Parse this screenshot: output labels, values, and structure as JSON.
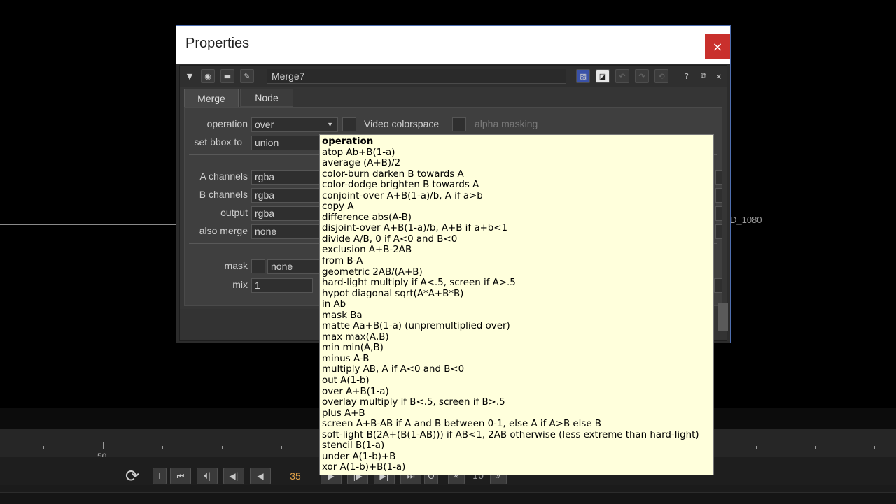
{
  "viewer": {
    "format_label": "D_1080"
  },
  "timeline": {
    "tick_label": "50",
    "current_frame": "35",
    "increment": "10",
    "buttons": [
      "I",
      "⏮",
      "⏴|",
      "◀|",
      "◀",
      "▶",
      "|▶",
      "▶|",
      "⏭",
      "O"
    ]
  },
  "window": {
    "title": "Properties",
    "close_label": "×",
    "node_name": "Merge7",
    "tabs": [
      {
        "label": "Merge",
        "active": true
      },
      {
        "label": "Node",
        "active": false
      }
    ],
    "toolbar_right": [
      "?",
      "⧉",
      "×"
    ],
    "fields": {
      "operation_label": "operation",
      "operation_value": "over",
      "video_colorspace_label": "Video colorspace",
      "alpha_masking_label": "alpha masking",
      "set_bbox_label": "set bbox to",
      "set_bbox_value": "union",
      "a_channels_label": "A channels",
      "a_channels_value": "rgba",
      "b_channels_label": "B channels",
      "b_channels_value": "rgba",
      "output_label": "output",
      "output_value": "rgba",
      "also_merge_label": "also merge",
      "also_merge_value": "none",
      "mask_label": "mask",
      "mask_value": "none",
      "mix_label": "mix",
      "mix_value": "1"
    }
  },
  "dropdown": {
    "header": "operation",
    "items": [
      "atop Ab+B(1-a)",
      "average (A+B)/2",
      "color-burn darken B towards A",
      "color-dodge brighten B towards A",
      "conjoint-over A+B(1-a)/b, A if a>b",
      "copy A",
      "difference abs(A-B)",
      "disjoint-over A+B(1-a)/b, A+B if a+b<1",
      "divide A/B, 0 if A<0 and B<0",
      "exclusion A+B-2AB",
      "from B-A",
      "geometric 2AB/(A+B)",
      "hard-light multiply if A<.5, screen if A>.5",
      "hypot diagonal sqrt(A*A+B*B)",
      "in Ab",
      "mask Ba",
      "matte Aa+B(1-a) (unpremultiplied over)",
      "max max(A,B)",
      "min min(A,B)",
      "minus A-B",
      "multiply AB, A if A<0 and B<0",
      "out A(1-b)",
      "over A+B(1-a)",
      "overlay multiply if B<.5, screen if B>.5",
      "plus A+B",
      "screen A+B-AB if A and B between 0-1, else A if A>B else B",
      "soft-light B(2A+(B(1-AB))) if AB<1, 2AB otherwise (less extreme than hard-light)",
      "stencil B(1-a)",
      "under A(1-b)+B",
      "xor A(1-b)+B(1-a)"
    ]
  }
}
